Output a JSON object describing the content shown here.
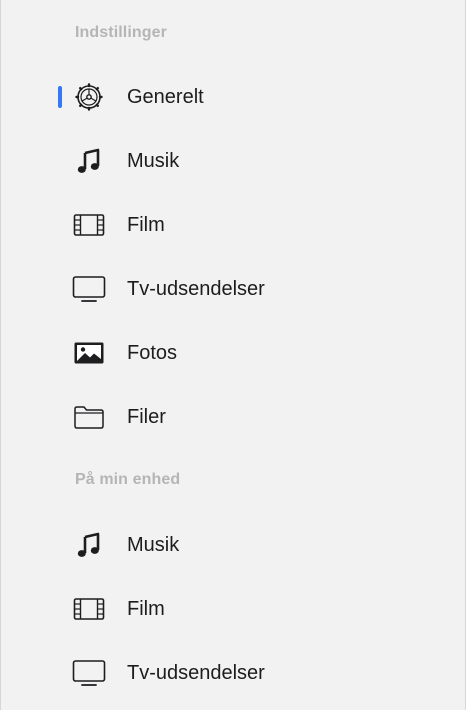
{
  "sections": [
    {
      "header": "Indstillinger",
      "items": [
        {
          "label": "Generelt",
          "icon": "gear-icon",
          "selected": true
        },
        {
          "label": "Musik",
          "icon": "music-note-icon"
        },
        {
          "label": "Film",
          "icon": "film-icon"
        },
        {
          "label": "Tv-udsendelser",
          "icon": "tv-icon"
        },
        {
          "label": "Fotos",
          "icon": "photo-icon"
        },
        {
          "label": "Filer",
          "icon": "folder-icon"
        }
      ]
    },
    {
      "header": "På min enhed",
      "items": [
        {
          "label": "Musik",
          "icon": "music-note-icon"
        },
        {
          "label": "Film",
          "icon": "film-icon"
        },
        {
          "label": "Tv-udsendelser",
          "icon": "tv-icon"
        }
      ]
    }
  ],
  "colors": {
    "accent": "#3478f6",
    "background": "#f2f2f2",
    "header": "#b5b5b5",
    "text": "#1d1d1f"
  }
}
